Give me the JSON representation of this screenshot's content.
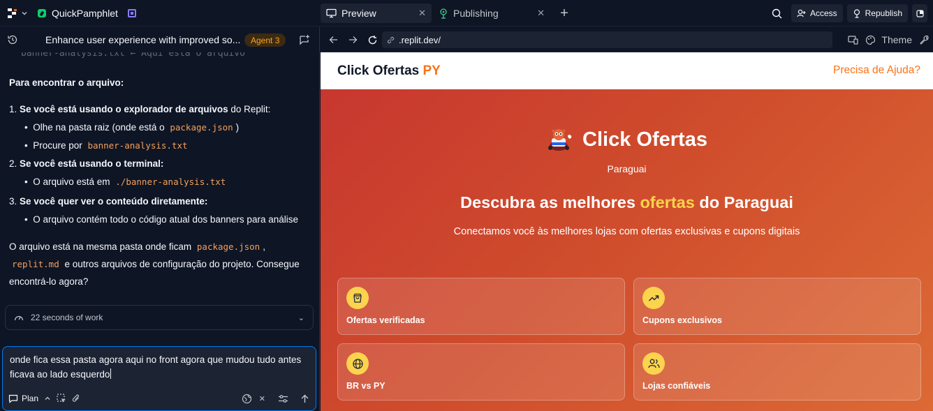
{
  "topbar": {
    "project_name": "QuickPamphlet",
    "tabs": [
      {
        "label": "Preview",
        "active": true
      },
      {
        "label": "Publishing",
        "active": false
      }
    ],
    "access_label": "Access",
    "republish_label": "Republish"
  },
  "chat": {
    "title": "Enhance user experience with improved so...",
    "agent_badge": "Agent 3",
    "cut_line": "banner-analysis.txt ← Aqui está o arquivo",
    "find_heading": "Para encontrar o arquivo:",
    "step1_bold": "Se você está usando o explorador de arquivos",
    "step1_rest": " do Replit:",
    "step1_b1_text": "Olhe na pasta raiz (onde está o ",
    "step1_b1_code": "package.json",
    "step1_b1_end": ")",
    "step1_b2_text": "Procure por ",
    "step1_b2_code": "banner-analysis.txt",
    "step2_bold": "Se você está usando o terminal:",
    "step2_b1_text": "O arquivo está em ",
    "step2_b1_code": "./banner-analysis.txt",
    "step3_bold": "Se você quer ver o conteúdo diretamente:",
    "step3_b1_text": "O arquivo contém todo o código atual dos banners para análise",
    "para_text1": "O arquivo está na mesma pasta onde ficam ",
    "para_code1": "package.json",
    "para_comma": ",",
    "para_code2": "replit.md",
    "para_text2": " e outros arquivos de configuração do projeto. Consegue encontrá-lo agora?",
    "work_label": "22 seconds of work",
    "input_text": "onde fica essa pasta agora aqui no front agora que mudou tudo antes ficava ao lado esquerdo",
    "plan_label": "Plan"
  },
  "browser": {
    "url": ".replit.dev/",
    "theme_label": "Theme"
  },
  "site": {
    "logo_main": "Click Ofertas ",
    "logo_accent": "PY",
    "help_link": "Precisa de Ajuda?",
    "brand_name": "Click Ofertas",
    "country": "Paraguai",
    "headline_pre": "Descubra as melhores ",
    "headline_hl": "ofertas",
    "headline_post": " do Paraguai",
    "subheadline": "Conectamos você às melhores lojas com ofertas exclusivas e cupons digitais",
    "cards": [
      {
        "label": "Ofertas verificadas",
        "icon": "shopping-bag-icon"
      },
      {
        "label": "Cupons exclusivos",
        "icon": "trending-up-icon"
      },
      {
        "label": "BR vs PY",
        "icon": "globe-icon"
      },
      {
        "label": "Lojas confiáveis",
        "icon": "users-icon"
      }
    ]
  },
  "colors": {
    "accent_orange": "#f97316",
    "highlight_yellow": "#fcd34d",
    "focus_blue": "#0079f2"
  }
}
